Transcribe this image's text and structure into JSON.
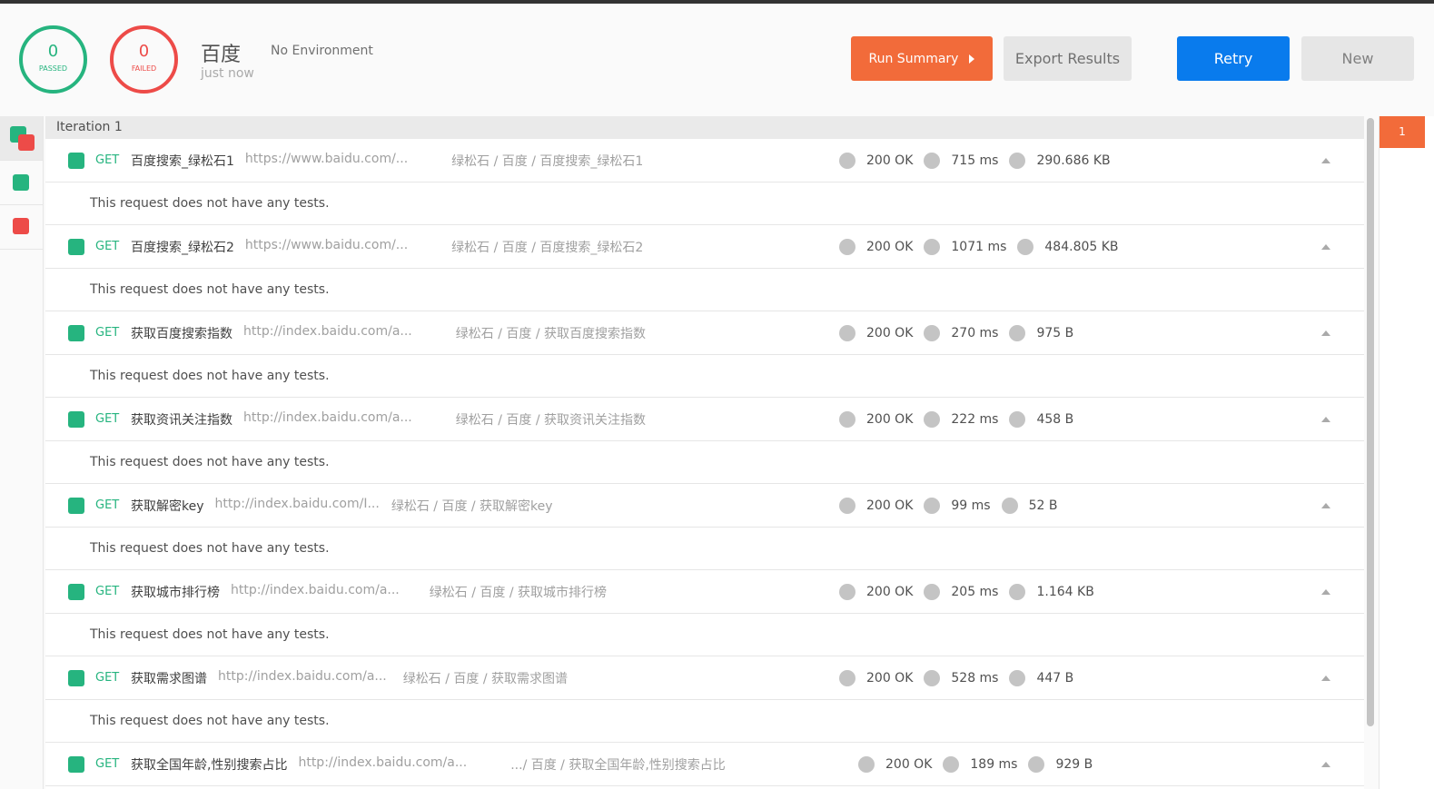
{
  "summary": {
    "passed": "0",
    "passed_label": "PASSED",
    "failed": "0",
    "failed_label": "FAILED",
    "collection": "百度",
    "time": "just now",
    "environment": "No Environment"
  },
  "buttons": {
    "run_summary": "Run Summary",
    "export": "Export Results",
    "retry": "Retry",
    "new": "New"
  },
  "iteration_label": "Iteration 1",
  "iteration_tab": "1",
  "requests": [
    {
      "method": "GET",
      "name": "百度搜索_绿松石1",
      "url": "https://www.baidu.com/...",
      "path": "绿松石 / 百度 / 百度搜索_绿松石1",
      "status": "200 OK",
      "time": "715 ms",
      "size": "290.686 KB",
      "tests": "This request does not have any tests."
    },
    {
      "method": "GET",
      "name": "百度搜索_绿松石2",
      "url": "https://www.baidu.com/...",
      "path": "绿松石 / 百度 / 百度搜索_绿松石2",
      "status": "200 OK",
      "time": "1071 ms",
      "size": "484.805 KB",
      "tests": "This request does not have any tests."
    },
    {
      "method": "GET",
      "name": "获取百度搜索指数",
      "url": "http://index.baidu.com/a...",
      "path": "绿松石 / 百度 / 获取百度搜索指数",
      "status": "200 OK",
      "time": "270 ms",
      "size": "975 B",
      "tests": "This request does not have any tests."
    },
    {
      "method": "GET",
      "name": "获取资讯关注指数",
      "url": "http://index.baidu.com/a...",
      "path": "绿松石 / 百度 / 获取资讯关注指数",
      "status": "200 OK",
      "time": "222 ms",
      "size": "458 B",
      "tests": "This request does not have any tests."
    },
    {
      "method": "GET",
      "name": "获取解密key",
      "url": "http://index.baidu.com/I...",
      "path": "绿松石 / 百度 / 获取解密key",
      "status": "200 OK",
      "time": "99 ms",
      "size": "52 B",
      "tests": "This request does not have any tests."
    },
    {
      "method": "GET",
      "name": "获取城市排行榜",
      "url": "http://index.baidu.com/a...",
      "path": "绿松石 / 百度 / 获取城市排行榜",
      "status": "200 OK",
      "time": "205 ms",
      "size": "1.164 KB",
      "tests": "This request does not have any tests."
    },
    {
      "method": "GET",
      "name": "获取需求图谱",
      "url": "http://index.baidu.com/a...",
      "path": "绿松石 / 百度 / 获取需求图谱",
      "status": "200 OK",
      "time": "528 ms",
      "size": "447 B",
      "tests": "This request does not have any tests."
    },
    {
      "method": "GET",
      "name": "获取全国年龄,性别搜索占比",
      "url": "http://index.baidu.com/a...",
      "path": ".../ 百度 / 获取全国年龄,性别搜索占比",
      "status": "200 OK",
      "time": "189 ms",
      "size": "929 B"
    }
  ]
}
